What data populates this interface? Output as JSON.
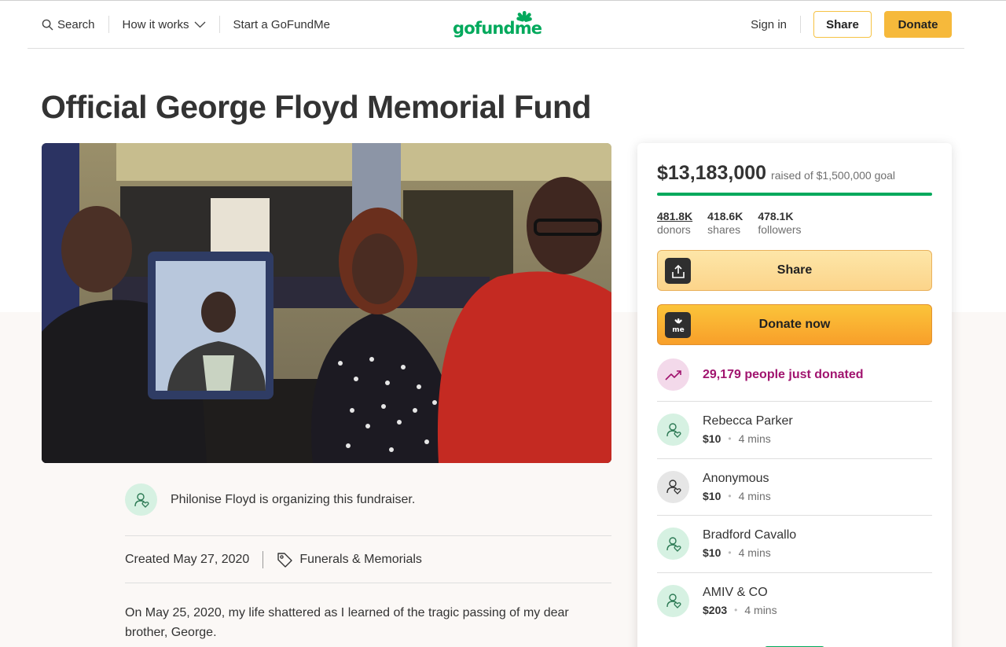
{
  "header": {
    "search": "Search",
    "how_it_works": "How it works",
    "start": "Start a GoFundMe",
    "logo": "gofundme",
    "sign_in": "Sign in",
    "share": "Share",
    "donate": "Donate"
  },
  "campaign": {
    "title": "Official George Floyd Memorial Fund",
    "organizer": "Philonise Floyd is organizing this fundraiser.",
    "created": "Created May 27, 2020",
    "category": "Funerals & Memorials",
    "story": "On May 25, 2020, my life shattered as I learned of the tragic passing of my dear brother, George."
  },
  "sidebar": {
    "raised": "$13,183,000",
    "goal": "raised of $1,500,000 goal",
    "progress_fraction": 1.0,
    "stats": [
      {
        "num": "481.8K",
        "label": "donors"
      },
      {
        "num": "418.6K",
        "label": "shares"
      },
      {
        "num": "478.1K",
        "label": "followers"
      }
    ],
    "share_label": "Share",
    "donate_label": "Donate now",
    "just_donated": "29,179 people just donated",
    "donations": [
      {
        "name": "Rebecca Parker",
        "amount": "$10",
        "time": "4 mins"
      },
      {
        "name": "Anonymous",
        "amount": "$10",
        "time": "4 mins"
      },
      {
        "name": "Bradford Cavallo",
        "amount": "$10",
        "time": "4 mins"
      },
      {
        "name": "AMIV & CO",
        "amount": "$203",
        "time": "4 mins"
      }
    ]
  },
  "colors": {
    "brand_green": "#02a95c",
    "donate_orange": "#f6b93b",
    "highlight_magenta": "#a1146f"
  }
}
